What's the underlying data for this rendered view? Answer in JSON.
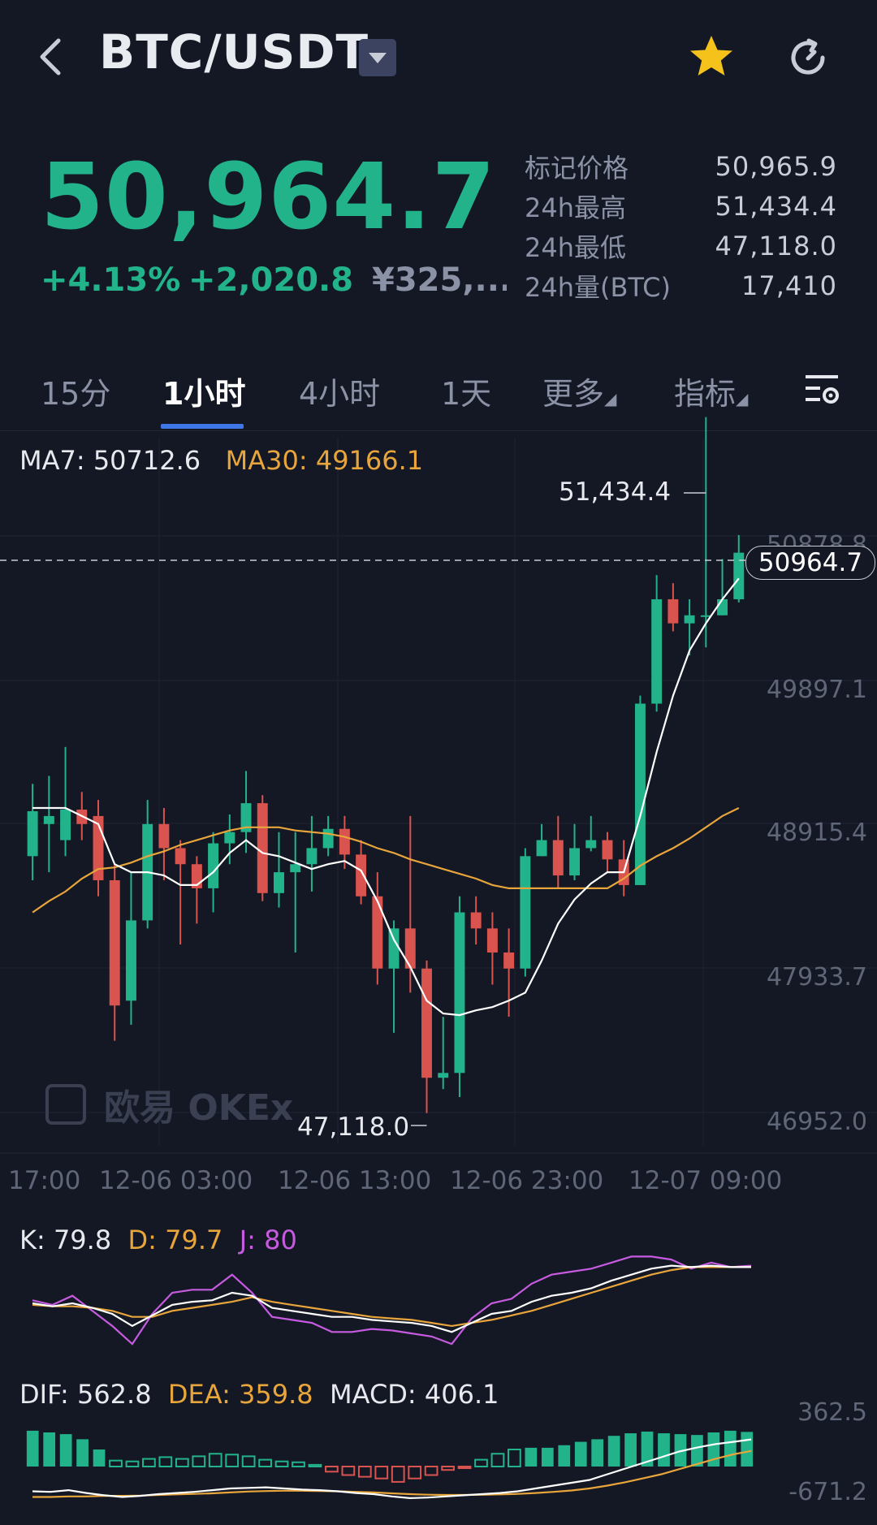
{
  "header": {
    "pair": "BTC/USDT",
    "icons": {
      "back": "back-arrow-icon",
      "caret": "caret-down-icon",
      "favorite": "star-icon",
      "refresh": "refresh-icon"
    },
    "favorite_color": "#f5c21b"
  },
  "ticker": {
    "last_price": "50,964.7",
    "change_percent": "+4.13%",
    "change_amount": "+2,020.8",
    "cny_price": "¥325,...",
    "up_color": "#22b38a",
    "stats": [
      {
        "label": "标记价格",
        "value": "50,965.9"
      },
      {
        "label": "24h最高",
        "value": "51,434.4"
      },
      {
        "label": "24h最低",
        "value": "47,118.0"
      },
      {
        "label": "24h量(BTC)",
        "value": "17,410"
      }
    ]
  },
  "tabs": [
    {
      "label": "15分",
      "active": false
    },
    {
      "label": "1小时",
      "active": true
    },
    {
      "label": "4小时",
      "active": false
    },
    {
      "label": "1天",
      "active": false
    },
    {
      "label": "更多",
      "active": false
    },
    {
      "label": "指标",
      "active": false
    }
  ],
  "tab_settings_icon": "chart-settings-icon",
  "indicators": {
    "ma7_label": "MA7: 50712.6",
    "ma30_label": "MA30: 49166.1",
    "k_label": "K: 79.8",
    "d_label": "D: 79.7",
    "j_label": "J: 80",
    "dif_label": "DIF: 562.8",
    "dea_label": "DEA: 359.8",
    "macd_label": "MACD: 406.1"
  },
  "price_axis": [
    "50878.8",
    "49897.1",
    "48915.4",
    "47933.7",
    "46952.0"
  ],
  "current_price_tag": "50964.7",
  "high_marker": "51,434.4",
  "low_marker": "47,118.0",
  "time_axis": [
    "17:00",
    "12-06 03:00",
    "12-06 13:00",
    "12-06 23:00",
    "12-07 09:00"
  ],
  "macd_axis": [
    "362.5",
    "-671.2"
  ],
  "watermark": "欧易 OKEx",
  "colors": {
    "up": "#22b38a",
    "down": "#d9534f",
    "ma7": "#ffffff",
    "ma30": "#e8a53c",
    "j": "#c65be0",
    "grid": "#1f2434"
  },
  "chart_data": {
    "type": "candlestick",
    "interval": "1h",
    "ylim": [
      46952.0,
      51200.0
    ],
    "candles": [
      {
        "o": 48700,
        "c": 48980,
        "h": 49150,
        "l": 48550
      },
      {
        "o": 48900,
        "c": 48950,
        "h": 49200,
        "l": 48600
      },
      {
        "o": 48800,
        "c": 48990,
        "h": 49380,
        "l": 48700
      },
      {
        "o": 48990,
        "c": 48900,
        "h": 49100,
        "l": 48800
      },
      {
        "o": 48950,
        "c": 48550,
        "h": 49050,
        "l": 48450
      },
      {
        "o": 48550,
        "c": 47770,
        "h": 48650,
        "l": 47550
      },
      {
        "o": 47800,
        "c": 48300,
        "h": 48600,
        "l": 47650
      },
      {
        "o": 48300,
        "c": 48900,
        "h": 49050,
        "l": 48250
      },
      {
        "o": 48900,
        "c": 48750,
        "h": 49000,
        "l": 48550
      },
      {
        "o": 48750,
        "c": 48650,
        "h": 48800,
        "l": 48150
      },
      {
        "o": 48650,
        "c": 48500,
        "h": 48700,
        "l": 48280
      },
      {
        "o": 48500,
        "c": 48780,
        "h": 48850,
        "l": 48350
      },
      {
        "o": 48780,
        "c": 48850,
        "h": 48960,
        "l": 48650
      },
      {
        "o": 48850,
        "c": 49030,
        "h": 49230,
        "l": 48720
      },
      {
        "o": 49030,
        "c": 48470,
        "h": 49080,
        "l": 48420
      },
      {
        "o": 48470,
        "c": 48600,
        "h": 48850,
        "l": 48380
      },
      {
        "o": 48600,
        "c": 48650,
        "h": 48850,
        "l": 48100
      },
      {
        "o": 48650,
        "c": 48750,
        "h": 48950,
        "l": 48480
      },
      {
        "o": 48750,
        "c": 48870,
        "h": 48950,
        "l": 48700
      },
      {
        "o": 48870,
        "c": 48710,
        "h": 48950,
        "l": 48620
      },
      {
        "o": 48710,
        "c": 48450,
        "h": 48800,
        "l": 48400
      },
      {
        "o": 48450,
        "c": 48000,
        "h": 48600,
        "l": 47900
      },
      {
        "o": 48000,
        "c": 48250,
        "h": 48300,
        "l": 47600
      },
      {
        "o": 48250,
        "c": 48000,
        "h": 48950,
        "l": 47850
      },
      {
        "o": 48000,
        "c": 47320,
        "h": 48050,
        "l": 47100
      },
      {
        "o": 47320,
        "c": 47350,
        "h": 47700,
        "l": 47250
      },
      {
        "o": 47350,
        "c": 48350,
        "h": 48450,
        "l": 47200
      },
      {
        "o": 48350,
        "c": 48250,
        "h": 48450,
        "l": 48150
      },
      {
        "o": 48250,
        "c": 48100,
        "h": 48350,
        "l": 47900
      },
      {
        "o": 48100,
        "c": 48000,
        "h": 48250,
        "l": 47700
      },
      {
        "o": 48000,
        "c": 48700,
        "h": 48750,
        "l": 47950
      },
      {
        "o": 48700,
        "c": 48800,
        "h": 48900,
        "l": 48700
      },
      {
        "o": 48800,
        "c": 48580,
        "h": 48950,
        "l": 48500
      },
      {
        "o": 48580,
        "c": 48750,
        "h": 48900,
        "l": 48550
      },
      {
        "o": 48750,
        "c": 48800,
        "h": 48950,
        "l": 48730
      },
      {
        "o": 48800,
        "c": 48680,
        "h": 48850,
        "l": 48600
      },
      {
        "o": 48680,
        "c": 48520,
        "h": 48800,
        "l": 48450
      },
      {
        "o": 48520,
        "c": 49650,
        "h": 49700,
        "l": 48520
      },
      {
        "o": 49650,
        "c": 50300,
        "h": 50450,
        "l": 49600
      },
      {
        "o": 50300,
        "c": 50150,
        "h": 50400,
        "l": 50100
      },
      {
        "o": 50150,
        "c": 50200,
        "h": 50300,
        "l": 49950
      },
      {
        "o": 50200,
        "c": 50200,
        "h": 51434.4,
        "l": 50000
      },
      {
        "o": 50200,
        "c": 50300,
        "h": 50550,
        "l": 50200
      },
      {
        "o": 50300,
        "c": 50590,
        "h": 50700,
        "l": 50280
      }
    ],
    "ma7": [
      49000,
      49000,
      49000,
      48950,
      48900,
      48650,
      48600,
      48600,
      48580,
      48520,
      48520,
      48600,
      48720,
      48800,
      48720,
      48700,
      48660,
      48620,
      48650,
      48670,
      48610,
      48420,
      48180,
      48010,
      47800,
      47720,
      47710,
      47740,
      47760,
      47800,
      47850,
      48050,
      48280,
      48430,
      48530,
      48600,
      48600,
      48950,
      49350,
      49700,
      49980,
      50150,
      50300,
      50430
    ],
    "ma30": [
      48350,
      48420,
      48480,
      48560,
      48620,
      48630,
      48660,
      48700,
      48730,
      48770,
      48800,
      48830,
      48860,
      48880,
      48880,
      48880,
      48860,
      48850,
      48840,
      48820,
      48790,
      48750,
      48720,
      48680,
      48650,
      48620,
      48590,
      48560,
      48520,
      48500,
      48500,
      48500,
      48500,
      48500,
      48500,
      48500,
      48560,
      48640,
      48700,
      48750,
      48810,
      48880,
      48950,
      49000
    ],
    "kdj": {
      "k": [
        55,
        53,
        55,
        52,
        48,
        40,
        47,
        54,
        56,
        57,
        62,
        60,
        52,
        50,
        48,
        46,
        46,
        44,
        43,
        42,
        40,
        36,
        42,
        48,
        50,
        56,
        60,
        62,
        65,
        70,
        74,
        78,
        80,
        79,
        80,
        79,
        79
      ],
      "d": [
        54,
        53,
        53,
        52,
        50,
        46,
        46,
        50,
        52,
        54,
        56,
        59,
        56,
        54,
        52,
        50,
        48,
        46,
        45,
        44,
        42,
        40,
        42,
        44,
        47,
        50,
        54,
        58,
        62,
        66,
        70,
        74,
        77,
        79,
        79,
        79,
        79
      ],
      "j": [
        57,
        54,
        60,
        50,
        40,
        28,
        48,
        62,
        64,
        64,
        74,
        62,
        46,
        44,
        42,
        36,
        36,
        38,
        37,
        35,
        33,
        28,
        45,
        55,
        58,
        68,
        74,
        76,
        78,
        82,
        86,
        86,
        84,
        78,
        82,
        79,
        80
      ]
    },
    "macd": {
      "hist": [
        420,
        400,
        380,
        320,
        200,
        70,
        60,
        90,
        110,
        90,
        120,
        150,
        140,
        120,
        80,
        60,
        50,
        20,
        -60,
        -100,
        -120,
        -140,
        -180,
        -140,
        -100,
        -40,
        -10,
        80,
        150,
        200,
        220,
        220,
        250,
        290,
        320,
        360,
        390,
        410,
        390,
        380,
        370,
        400,
        420,
        406
      ],
      "dif": [
        -350,
        -360,
        -330,
        -380,
        -420,
        -450,
        -430,
        -400,
        -380,
        -360,
        -330,
        -300,
        -290,
        -280,
        -300,
        -320,
        -330,
        -350,
        -380,
        -400,
        -440,
        -470,
        -460,
        -440,
        -420,
        -400,
        -380,
        -350,
        -300,
        -250,
        -200,
        -150,
        -50,
        50,
        150,
        250,
        350,
        420,
        480,
        520,
        562.8
      ],
      "dea": [
        -450,
        -450,
        -440,
        -440,
        -430,
        -430,
        -425,
        -415,
        -405,
        -395,
        -385,
        -370,
        -355,
        -345,
        -340,
        -340,
        -345,
        -350,
        -360,
        -370,
        -385,
        -400,
        -410,
        -415,
        -415,
        -412,
        -405,
        -395,
        -380,
        -360,
        -335,
        -300,
        -250,
        -190,
        -120,
        -50,
        40,
        130,
        220,
        300,
        359.8
      ]
    }
  }
}
